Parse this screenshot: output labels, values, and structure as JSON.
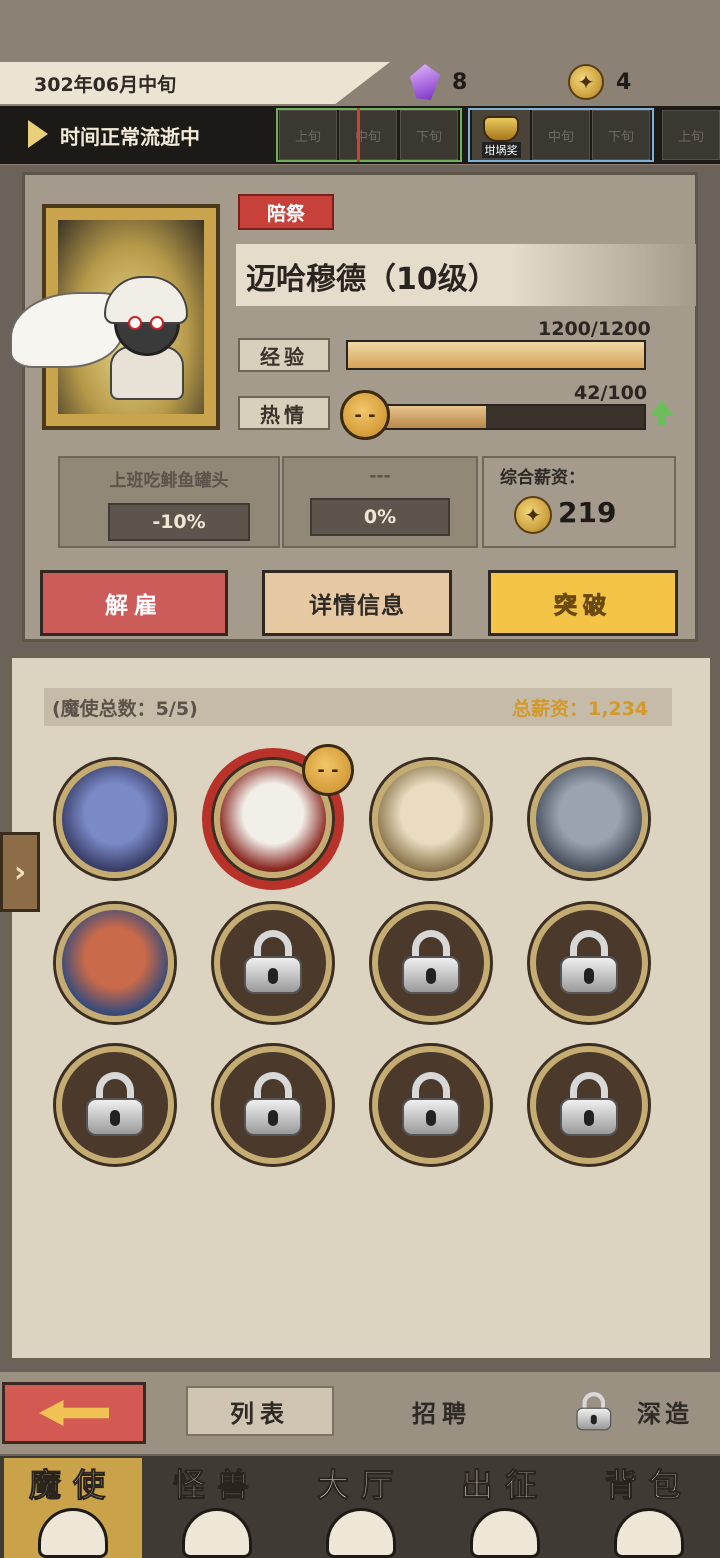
{
  "header": {
    "date": "302年06月中旬",
    "crystal_count": "8",
    "coin_count": "4",
    "time_status": "时间正常流逝中",
    "timeline": [
      "上旬",
      "中旬",
      "下旬",
      "中旬",
      "下旬",
      "上旬"
    ],
    "event_label": "坩埚奖"
  },
  "character": {
    "tag": "陪祭",
    "name": "迈哈穆德（10级）",
    "exp_label": "经验",
    "exp_value": "1200/1200",
    "exp_fraction": 1.0,
    "passion_label": "热情",
    "passion_value": "42/100",
    "passion_fraction": 0.42,
    "traits": [
      {
        "title": "上班吃鲱鱼罐头",
        "value": "-10%"
      },
      {
        "title": "---",
        "value": "0%"
      }
    ],
    "salary_title": "综合薪资：",
    "salary_value": "219"
  },
  "actions": {
    "dismiss": "解雇",
    "details": "详情信息",
    "breakthrough": "突破"
  },
  "roster": {
    "count_text": "(魔使总数：5/5)",
    "total_salary": "总薪资：1,234",
    "slots": [
      {
        "state": "filled",
        "name": "hooded-mage"
      },
      {
        "state": "filled",
        "name": "winged-priest"
      },
      {
        "state": "filled",
        "name": "lion-warrior"
      },
      {
        "state": "filled",
        "name": "horned-knight"
      },
      {
        "state": "filled",
        "name": "tribal-spearman"
      },
      {
        "state": "locked"
      },
      {
        "state": "locked"
      },
      {
        "state": "locked"
      },
      {
        "state": "locked"
      },
      {
        "state": "locked"
      },
      {
        "state": "locked"
      },
      {
        "state": "locked"
      }
    ]
  },
  "subnav": {
    "list": "列表",
    "recruit": "招聘",
    "advance": "深造"
  },
  "mainnav": [
    "魔使",
    "怪兽",
    "大厅",
    "出征",
    "背包"
  ],
  "colors": {
    "dismiss": "#cc5c5a",
    "details": "#e6c9a3",
    "breakthrough": "#f3c446",
    "accent_gold": "#d39a2a"
  }
}
